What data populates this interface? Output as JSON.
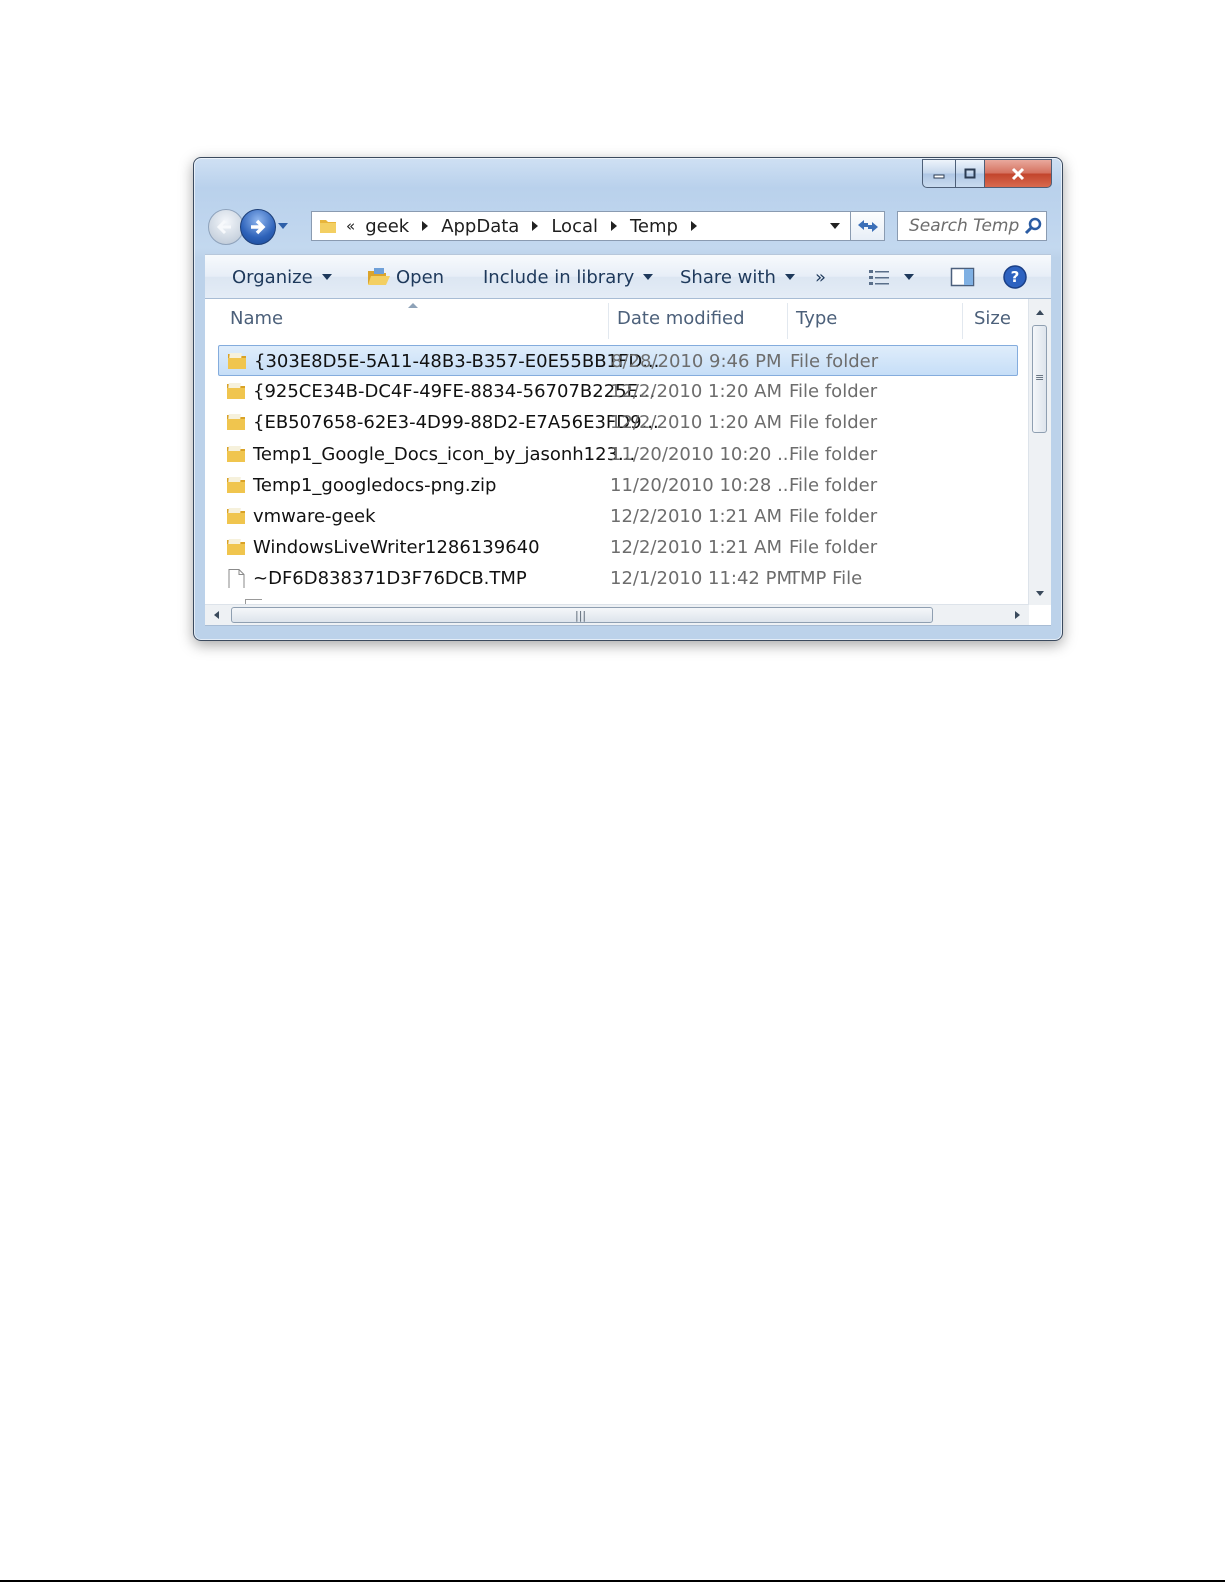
{
  "window": {
    "caption": {
      "minimize": "minimize",
      "maximize": "maximize",
      "close": "close"
    }
  },
  "nav": {
    "breadcrumb_overflow": "«",
    "breadcrumbs": [
      "geek",
      "AppData",
      "Local",
      "Temp"
    ],
    "search_placeholder": "Search Temp"
  },
  "toolbar": {
    "organize": "Organize",
    "open": "Open",
    "include_in_library": "Include in library",
    "share_with": "Share with",
    "more": "»"
  },
  "columns": {
    "name": "Name",
    "date_modified": "Date modified",
    "type": "Type",
    "size": "Size"
  },
  "files": [
    {
      "name": "{303E8D5E-5A11-48B3-B357-E0E55BB1FD...",
      "date": "8/28/2010 9:46 PM",
      "type": "File folder",
      "icon": "folder-icon",
      "selected": true
    },
    {
      "name": "{925CE34B-DC4F-49FE-8834-56707B225E...",
      "date": "12/2/2010 1:20 AM",
      "type": "File folder",
      "icon": "folder-icon"
    },
    {
      "name": "{EB507658-62E3-4D99-88D2-E7A56E3FD9...",
      "date": "12/2/2010 1:20 AM",
      "type": "File folder",
      "icon": "folder-icon"
    },
    {
      "name": "Temp1_Google_Docs_icon_by_jasonh123...",
      "date": "11/20/2010 10:20 ...",
      "type": "File folder",
      "icon": "folder-icon"
    },
    {
      "name": "Temp1_googledocs-png.zip",
      "date": "11/20/2010 10:28 ...",
      "type": "File folder",
      "icon": "folder-icon"
    },
    {
      "name": "vmware-geek",
      "date": "12/2/2010 1:21 AM",
      "type": "File folder",
      "icon": "folder-icon"
    },
    {
      "name": "WindowsLiveWriter1286139640",
      "date": "12/2/2010 1:21 AM",
      "type": "File folder",
      "icon": "folder-icon"
    },
    {
      "name": "~DF6D838371D3F76DCB.TMP",
      "date": "12/1/2010 11:42 PM",
      "type": "TMP File",
      "icon": "file-icon"
    }
  ],
  "colors": {
    "selection": "#cce8ff",
    "toolbar_text": "#1e395b",
    "folder": "#e8b53b"
  }
}
